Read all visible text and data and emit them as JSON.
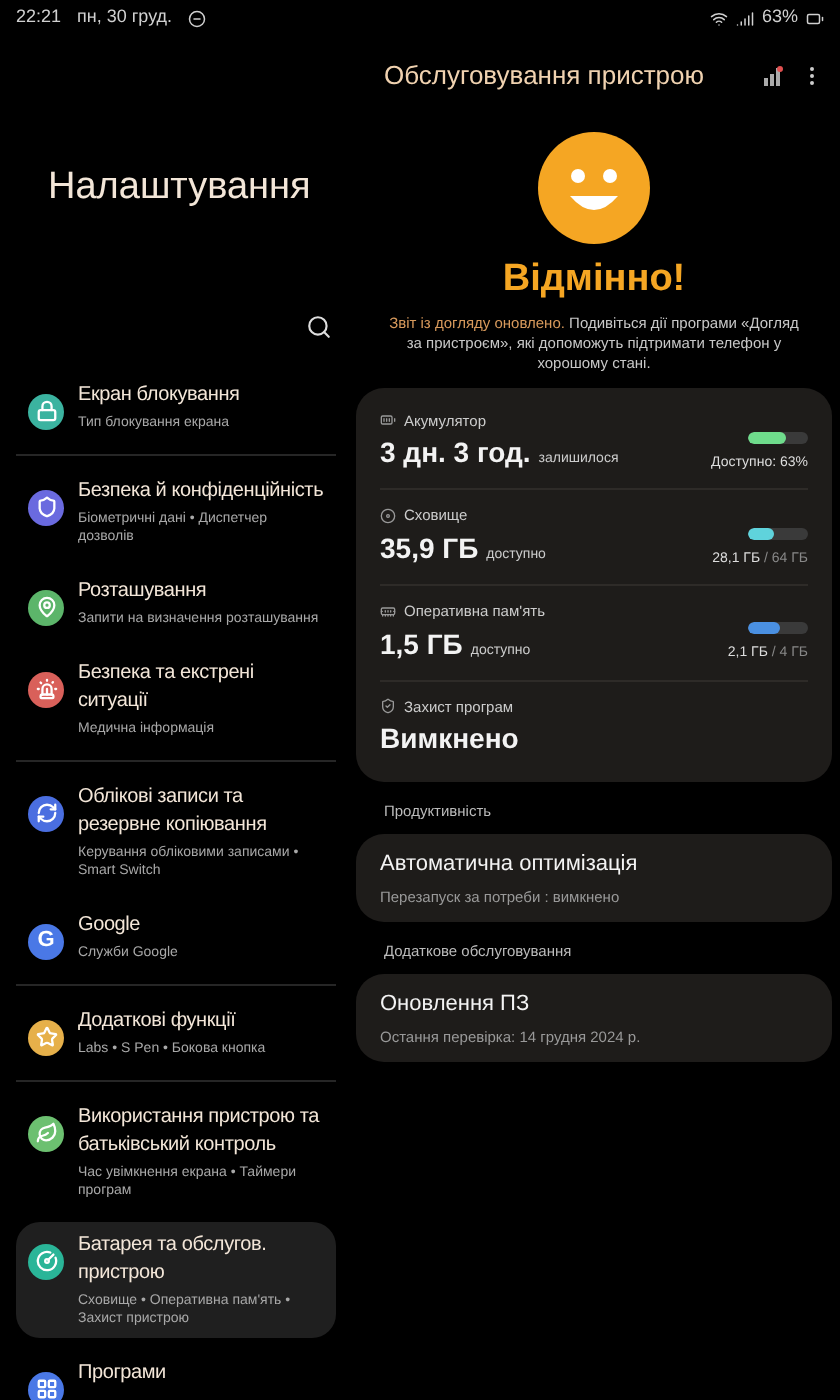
{
  "status_bar": {
    "time": "22:21",
    "date": "пн, 30 груд.",
    "battery": "63%"
  },
  "settings": {
    "title": "Налаштування",
    "groups": [
      [
        {
          "title": "Екран блокування",
          "subtitle": "Тип блокування екрана",
          "color": "#3bb3a0",
          "kind": "lock",
          "selected": false
        }
      ],
      [
        {
          "title": "Безпека й конфіденційність",
          "subtitle": "Біометричні дані  •  Диспетчер дозволів",
          "color": "#6a6adf",
          "kind": "shield",
          "selected": false
        },
        {
          "title": "Розташування",
          "subtitle": "Запити на визначення розташування",
          "color": "#5cb56a",
          "kind": "pin",
          "selected": false
        },
        {
          "title": "Безпека та екстрені ситуації",
          "subtitle": "Медична інформація",
          "color": "#d9605a",
          "kind": "alert",
          "selected": false
        }
      ],
      [
        {
          "title": "Облікові записи та резервне копіювання",
          "subtitle": "Керування обліковими записами  •  Smart Switch",
          "color": "#4a6ee0",
          "kind": "sync",
          "selected": false
        },
        {
          "title": "Google",
          "subtitle": "Служби Google",
          "color": "#4a78e6",
          "kind": "google",
          "icon_text": "G",
          "selected": false
        }
      ],
      [
        {
          "title": "Додаткові функції",
          "subtitle": "Labs  •  S Pen  •  Бокова кнопка",
          "color": "#e6b04a",
          "kind": "star",
          "selected": false
        }
      ],
      [
        {
          "title": "Використання пристрою та батьківський контроль",
          "subtitle": "Час увімкнення екрана  •  Таймери програм",
          "color": "#6cc070",
          "kind": "wellbeing",
          "selected": false
        },
        {
          "title": "Батарея та обслугов. пристрою",
          "subtitle": "Сховище  •  Оперативна пам'ять  •  Захист пристрою",
          "color": "#2ab598",
          "kind": "care",
          "selected": true
        },
        {
          "title": "Програми",
          "color": "#4a78e6",
          "kind": "apps",
          "selected": false
        }
      ]
    ]
  },
  "device_care": {
    "title": "Обслуговування пристрою",
    "status": "Відмінно!",
    "description": {
      "highlight": "Звіт із догляду оновлено.",
      "text": " Подивіться дії програми «Догляд за пристроєм», які допоможуть підтримати телефон у хорошому стані."
    },
    "metrics": [
      {
        "kind": "battery",
        "label": "Акумулятор",
        "value": "3 дн. 3 год.",
        "unit": "залишилося",
        "level": 0.63,
        "color": "#6fdc8c",
        "reading": "Доступно: 63%"
      },
      {
        "kind": "storage",
        "label": "Сховище",
        "value": "35,9 ГБ",
        "unit": "доступно",
        "level": 0.44,
        "color": "#5fd3dc",
        "reading": "28,1 ГБ",
        "total": " / 64 ГБ"
      },
      {
        "kind": "memory",
        "label": "Оперативна пам'ять",
        "value": "1,5 ГБ",
        "unit": "доступно",
        "level": 0.52,
        "color": "#4a90e2",
        "reading": "2,1 ГБ",
        "total": " / 4 ГБ"
      },
      {
        "kind": "protection",
        "label": "Захист програм",
        "value": "Вимкнено"
      }
    ],
    "sections": [
      {
        "header": "Продуктивність",
        "title": "Автоматична оптимізація",
        "subtitle": "Перезапуск за потреби : вимкнено"
      },
      {
        "header": "Додаткове обслуговування",
        "title": "Оновлення ПЗ",
        "subtitle": "Остання перевірка: 14 грудня 2024 р."
      }
    ]
  }
}
